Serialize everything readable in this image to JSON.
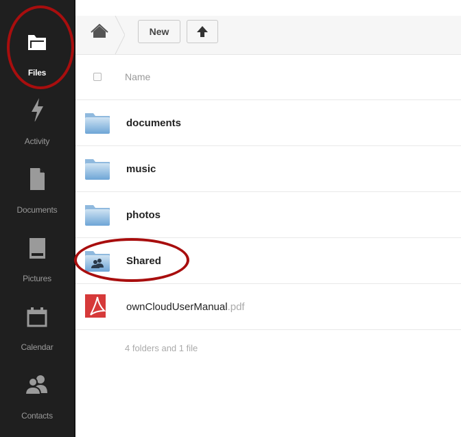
{
  "sidebar": {
    "items": [
      {
        "label": "Files",
        "icon": "folder-icon",
        "active": true
      },
      {
        "label": "Activity",
        "icon": "lightning-icon",
        "active": false
      },
      {
        "label": "Documents",
        "icon": "document-icon",
        "active": false
      },
      {
        "label": "Pictures",
        "icon": "picture-icon",
        "active": false
      },
      {
        "label": "Calendar",
        "icon": "calendar-icon",
        "active": false
      },
      {
        "label": "Contacts",
        "icon": "contacts-icon",
        "active": false
      }
    ]
  },
  "toolbar": {
    "new_label": "New",
    "home_icon": "home-icon",
    "upload_icon": "upload-arrow-icon"
  },
  "list": {
    "header_name": "Name",
    "files": [
      {
        "name": "documents",
        "ext": "",
        "type": "folder"
      },
      {
        "name": "music",
        "ext": "",
        "type": "folder"
      },
      {
        "name": "photos",
        "ext": "",
        "type": "folder"
      },
      {
        "name": "Shared",
        "ext": "",
        "type": "shared-folder"
      },
      {
        "name": "ownCloudUserManual",
        "ext": ".pdf",
        "type": "pdf"
      }
    ],
    "summary": "4 folders and 1 file"
  },
  "colors": {
    "sidebar_bg": "#1f1f1f",
    "annotation_red": "#a80e0e",
    "folder_blue": "#7fb2dd"
  }
}
